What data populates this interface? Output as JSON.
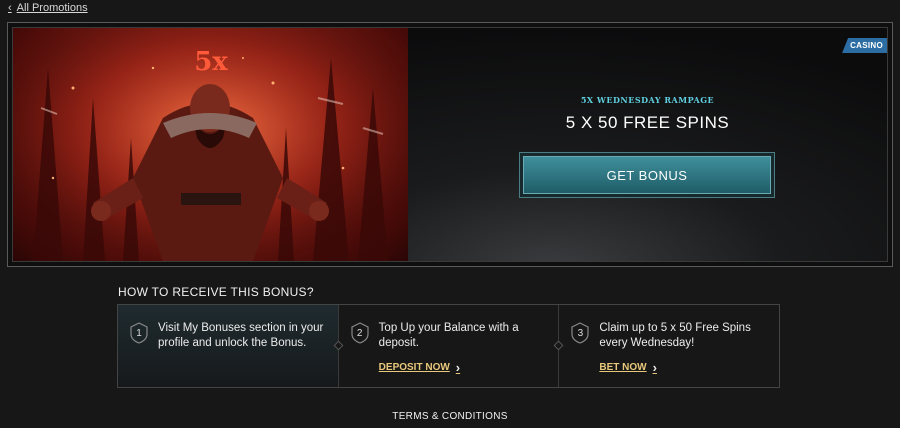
{
  "nav": {
    "back_label": "All Promotions"
  },
  "banner": {
    "tag": "CASINO",
    "art_text": "5x",
    "promo_subtitle": "5X WEDNESDAY RAMPAGE",
    "promo_title": "5 X 50 FREE SPINS",
    "cta_label": "GET BONUS"
  },
  "how": {
    "title": "HOW TO RECEIVE THIS BONUS?",
    "steps": [
      {
        "num": "1",
        "text": "Visit My Bonuses section in your profile and unlock the Bonus.",
        "link": ""
      },
      {
        "num": "2",
        "text": "Top Up your Balance with a deposit.",
        "link": "DEPOSIT NOW"
      },
      {
        "num": "3",
        "text": "Claim up to 5 x 50 Free Spins every Wednesday!",
        "link": "BET NOW"
      }
    ]
  },
  "footer": {
    "terms_label": "TERMS & CONDITIONS"
  },
  "colors": {
    "accent": "#5fd0e0",
    "link": "#e8c87a",
    "tag": "#2c6ea3"
  }
}
